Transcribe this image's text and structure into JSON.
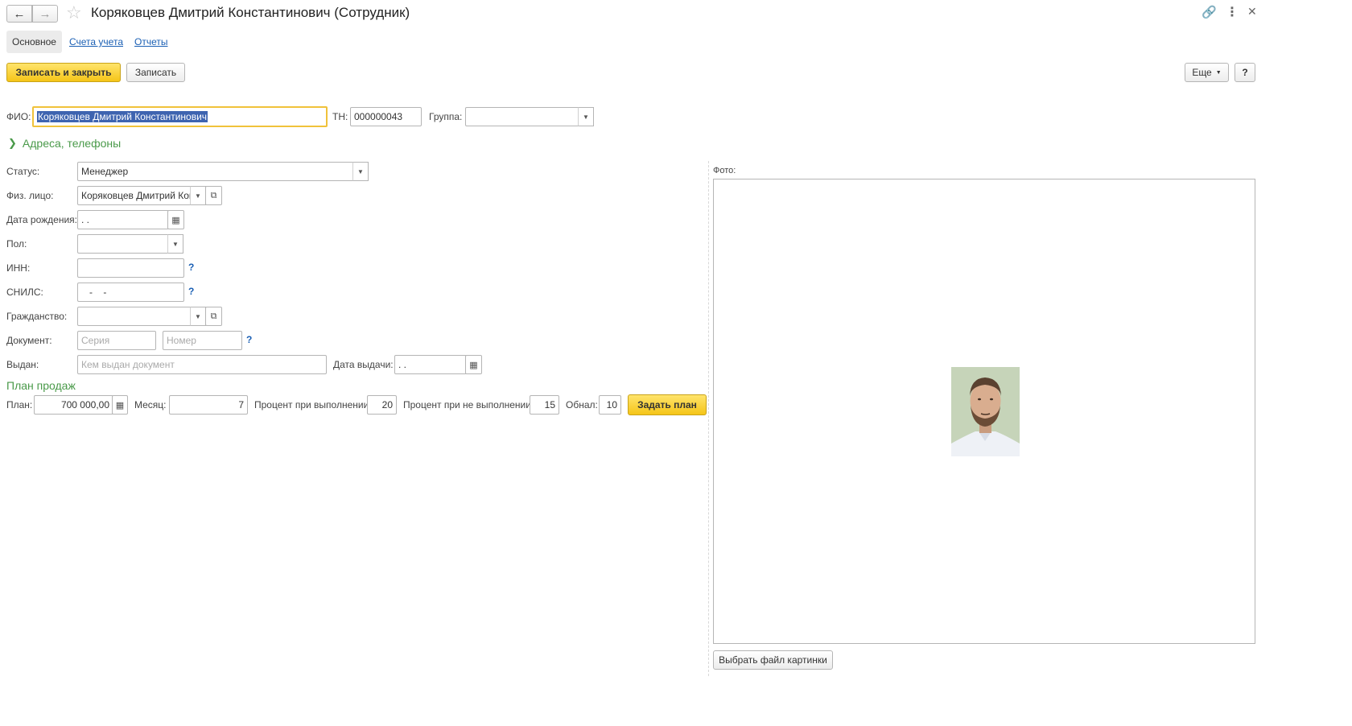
{
  "window": {
    "title": "Коряковцев Дмитрий Константинович (Сотрудник)"
  },
  "tabs": {
    "main": "Основное",
    "accounts": "Счета учета",
    "reports": "Отчеты"
  },
  "toolbar": {
    "save_close": "Записать и закрыть",
    "save": "Записать",
    "more": "Еще",
    "help": "?"
  },
  "header_fields": {
    "fio_label": "ФИО:",
    "fio_value": "Коряковцев Дмитрий Константинович",
    "tn_label": "ТН:",
    "tn_value": "000000043",
    "group_label": "Группа:",
    "group_value": ""
  },
  "addresses_section": "Адреса, телефоны",
  "form": {
    "status_label": "Статус:",
    "status_value": "Менеджер",
    "person_label": "Физ. лицо:",
    "person_value": "Коряковцев Дмитрий Константинович",
    "birth_label": "Дата рождения:",
    "birth_value": "  .  .",
    "gender_label": "Пол:",
    "gender_value": "",
    "inn_label": "ИНН:",
    "inn_value": "",
    "snils_label": "СНИЛС:",
    "snils_value": "   -    -",
    "citizenship_label": "Гражданство:",
    "citizenship_value": "",
    "document_label": "Документ:",
    "doc_series_placeholder": "Серия",
    "doc_number_placeholder": "Номер",
    "issued_label": "Выдан:",
    "issued_placeholder": "Кем выдан документ",
    "issue_date_label": "Дата выдачи:",
    "issue_date_value": "  .  .",
    "help_mark": "?"
  },
  "sales_plan": {
    "section_title": "План продаж",
    "plan_label": "План:",
    "plan_value": "700 000,00",
    "month_label": "Месяц:",
    "month_value": "7",
    "pct_done_label": "Процент при выполнении:",
    "pct_done_value": "20",
    "pct_not_done_label": "Процент при не выполнении:",
    "pct_not_done_value": "15",
    "cash_label": "Обнал:",
    "cash_value": "10",
    "set_plan_button": "Задать план"
  },
  "photo": {
    "label": "Фото:",
    "choose_button": "Выбрать файл картинки"
  },
  "icons": [
    "back-arrow-icon",
    "forward-arrow-icon",
    "star-icon",
    "link-icon",
    "more-vertical-icon",
    "close-icon",
    "dropdown-icon",
    "calendar-icon",
    "open-icon",
    "calculator-icon",
    "chevron-right-icon"
  ]
}
